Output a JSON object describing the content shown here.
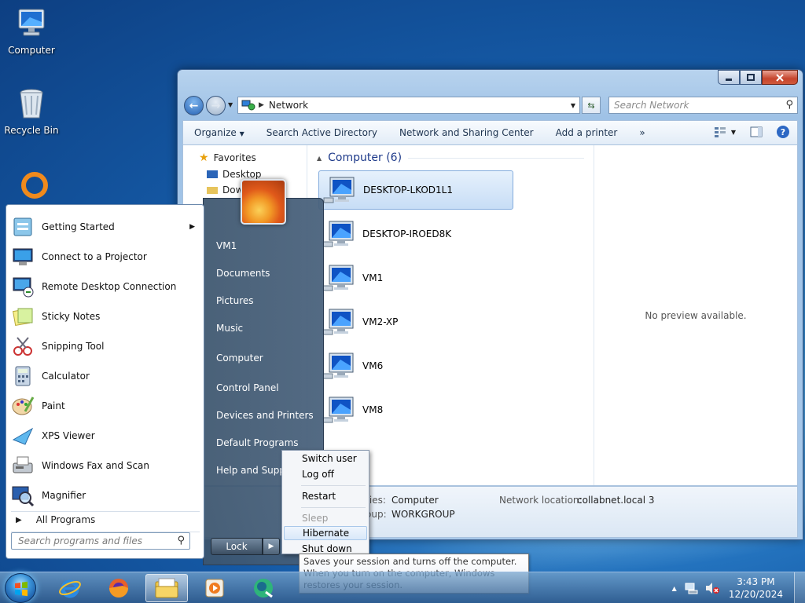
{
  "desktop": {
    "icons": [
      {
        "label": "Computer"
      },
      {
        "label": "Recycle Bin"
      }
    ]
  },
  "explorer": {
    "address": "Network",
    "search_placeholder": "Search Network",
    "toolbar": [
      "Organize",
      "Search Active Directory",
      "Network and Sharing Center",
      "Add a printer"
    ],
    "more_chevron": "»",
    "nav_items": [
      "Favorites",
      "Desktop",
      "Dow"
    ],
    "group_header": "Computer (6)",
    "computers": [
      "DESKTOP-LKOD1L1",
      "DESKTOP-IROED8K",
      "VM1",
      "VM2-XP",
      "VM6",
      "VM8"
    ],
    "preview_text": "No preview available.",
    "details": {
      "categories_label": "ries:",
      "categories_value": "Computer",
      "group_label": "oup:",
      "group_value": "WORKGROUP",
      "network_label": "Network location:",
      "network_value": "collabnet.local  3"
    }
  },
  "start_menu": {
    "programs": [
      "Getting Started",
      "Connect to a Projector",
      "Remote Desktop Connection",
      "Sticky Notes",
      "Snipping Tool",
      "Calculator",
      "Paint",
      "XPS Viewer",
      "Windows Fax and Scan",
      "Magnifier"
    ],
    "all_programs": "All Programs",
    "search_placeholder": "Search programs and files",
    "places": [
      "VM1",
      "Documents",
      "Pictures",
      "Music",
      "Computer",
      "Control Panel",
      "Devices and Printers",
      "Default Programs",
      "Help and Support"
    ],
    "lock_label": "Lock"
  },
  "shutdown_menu": {
    "options": [
      "Switch user",
      "Log off",
      "Restart",
      "Sleep",
      "Hibernate",
      "Shut down"
    ],
    "tooltip": "Saves your session and turns off the computer. When you turn on the computer, Windows restores your session."
  },
  "taskbar": {
    "time": "3:43 PM",
    "date": "12/20/2024"
  }
}
